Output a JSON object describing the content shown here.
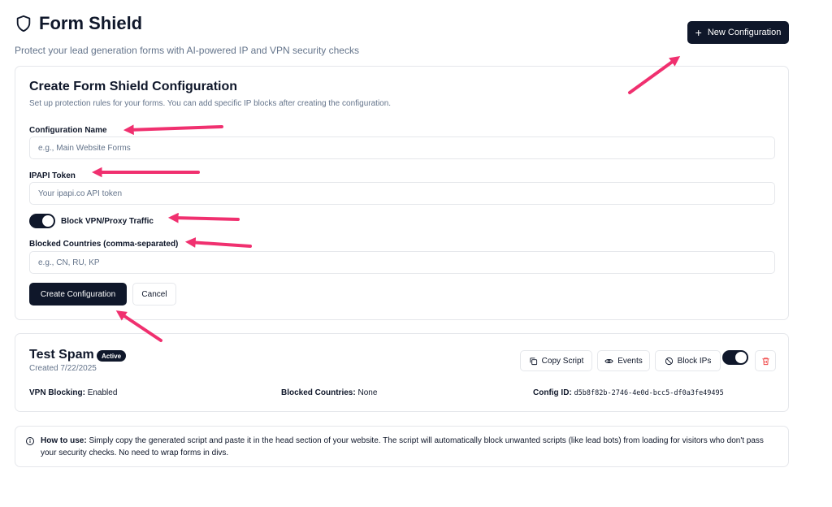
{
  "header": {
    "title": "Form Shield",
    "subtitle": "Protect your lead generation forms with AI-powered IP and VPN security checks",
    "new_button_label": "New Configuration"
  },
  "form": {
    "title": "Create Form Shield Configuration",
    "description": "Set up protection rules for your forms. You can add specific IP blocks after creating the configuration.",
    "config_name_label": "Configuration Name",
    "config_name_placeholder": "e.g., Main Website Forms",
    "token_label": "IPAPI Token",
    "token_placeholder": "Your ipapi.co API token",
    "vpn_toggle_label": "Block VPN/Proxy Traffic",
    "vpn_toggle_on": true,
    "countries_label": "Blocked Countries (comma-separated)",
    "countries_placeholder": "e.g., CN, RU, KP",
    "create_label": "Create Configuration",
    "cancel_label": "Cancel"
  },
  "config": {
    "name": "Test Spam",
    "status": "Active",
    "created": "Created 7/22/2025",
    "copy_label": "Copy Script",
    "events_label": "Events",
    "block_ips_label": "Block IPs",
    "enabled_toggle_on": true,
    "vpn_blocking_key": "VPN Blocking:",
    "vpn_blocking_value": "Enabled",
    "blocked_countries_key": "Blocked Countries:",
    "blocked_countries_value": "None",
    "config_id_key": "Config ID:",
    "config_id_value": "d5b8f82b-2746-4e0d-bcc5-df0a3fe49495"
  },
  "howto": {
    "title": "How to use:",
    "text": "Simply copy the generated script and paste it in the head section of your website. The script will automatically block unwanted scripts (like lead bots) from loading for visitors who don't pass your security checks. No need to wrap forms in divs."
  },
  "colors": {
    "primary": "#0f172a",
    "muted": "#64748b",
    "border": "#e5e7eb",
    "annotation_arrow": "#f0306f",
    "danger": "#ef4444"
  },
  "icons": [
    "shield-icon",
    "plus-icon",
    "copy-icon",
    "eye-icon",
    "ban-icon",
    "trash-icon",
    "info-icon"
  ]
}
